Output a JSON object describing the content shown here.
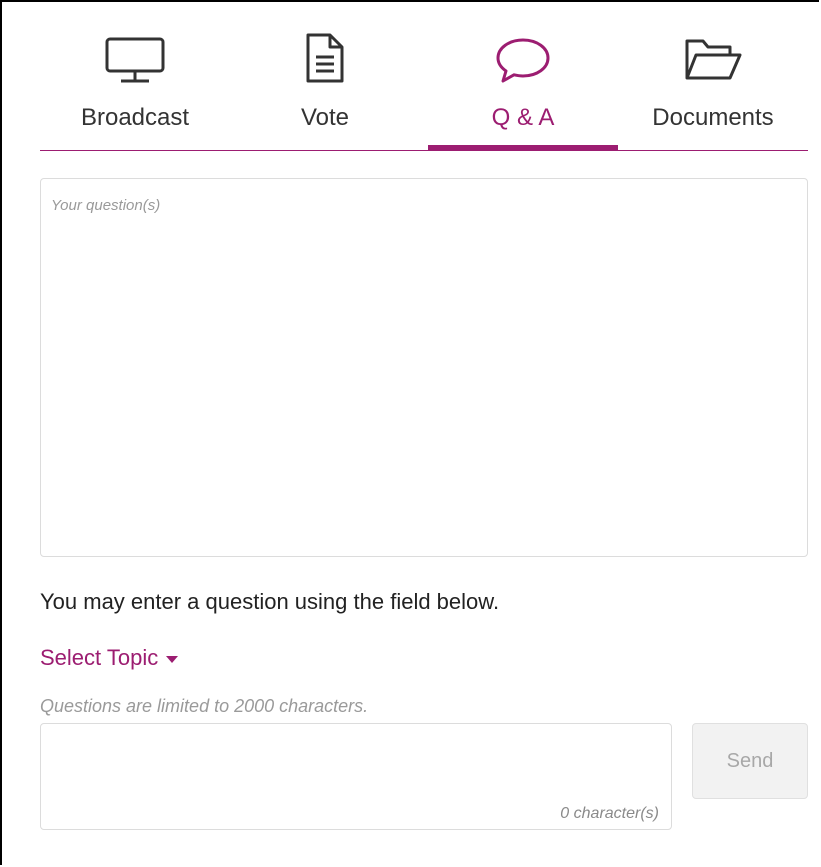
{
  "tabs": [
    {
      "label": "Broadcast",
      "icon": "monitor-icon",
      "active": false
    },
    {
      "label": "Vote",
      "icon": "document-icon",
      "active": false
    },
    {
      "label": "Q & A",
      "icon": "speech-bubble-icon",
      "active": true
    },
    {
      "label": "Documents",
      "icon": "folder-open-icon",
      "active": false
    }
  ],
  "question_area": {
    "placeholder": "Your question(s)"
  },
  "instruction": "You may enter a question using the field below.",
  "topic_select": {
    "label": "Select Topic"
  },
  "limit_note": "Questions are limited to 2000  characters.",
  "input": {
    "counter": "0 character(s)"
  },
  "send_label": "Send",
  "colors": {
    "accent": "#9c1d71",
    "border": "#dcdcdc",
    "muted": "#9a9a9a"
  }
}
